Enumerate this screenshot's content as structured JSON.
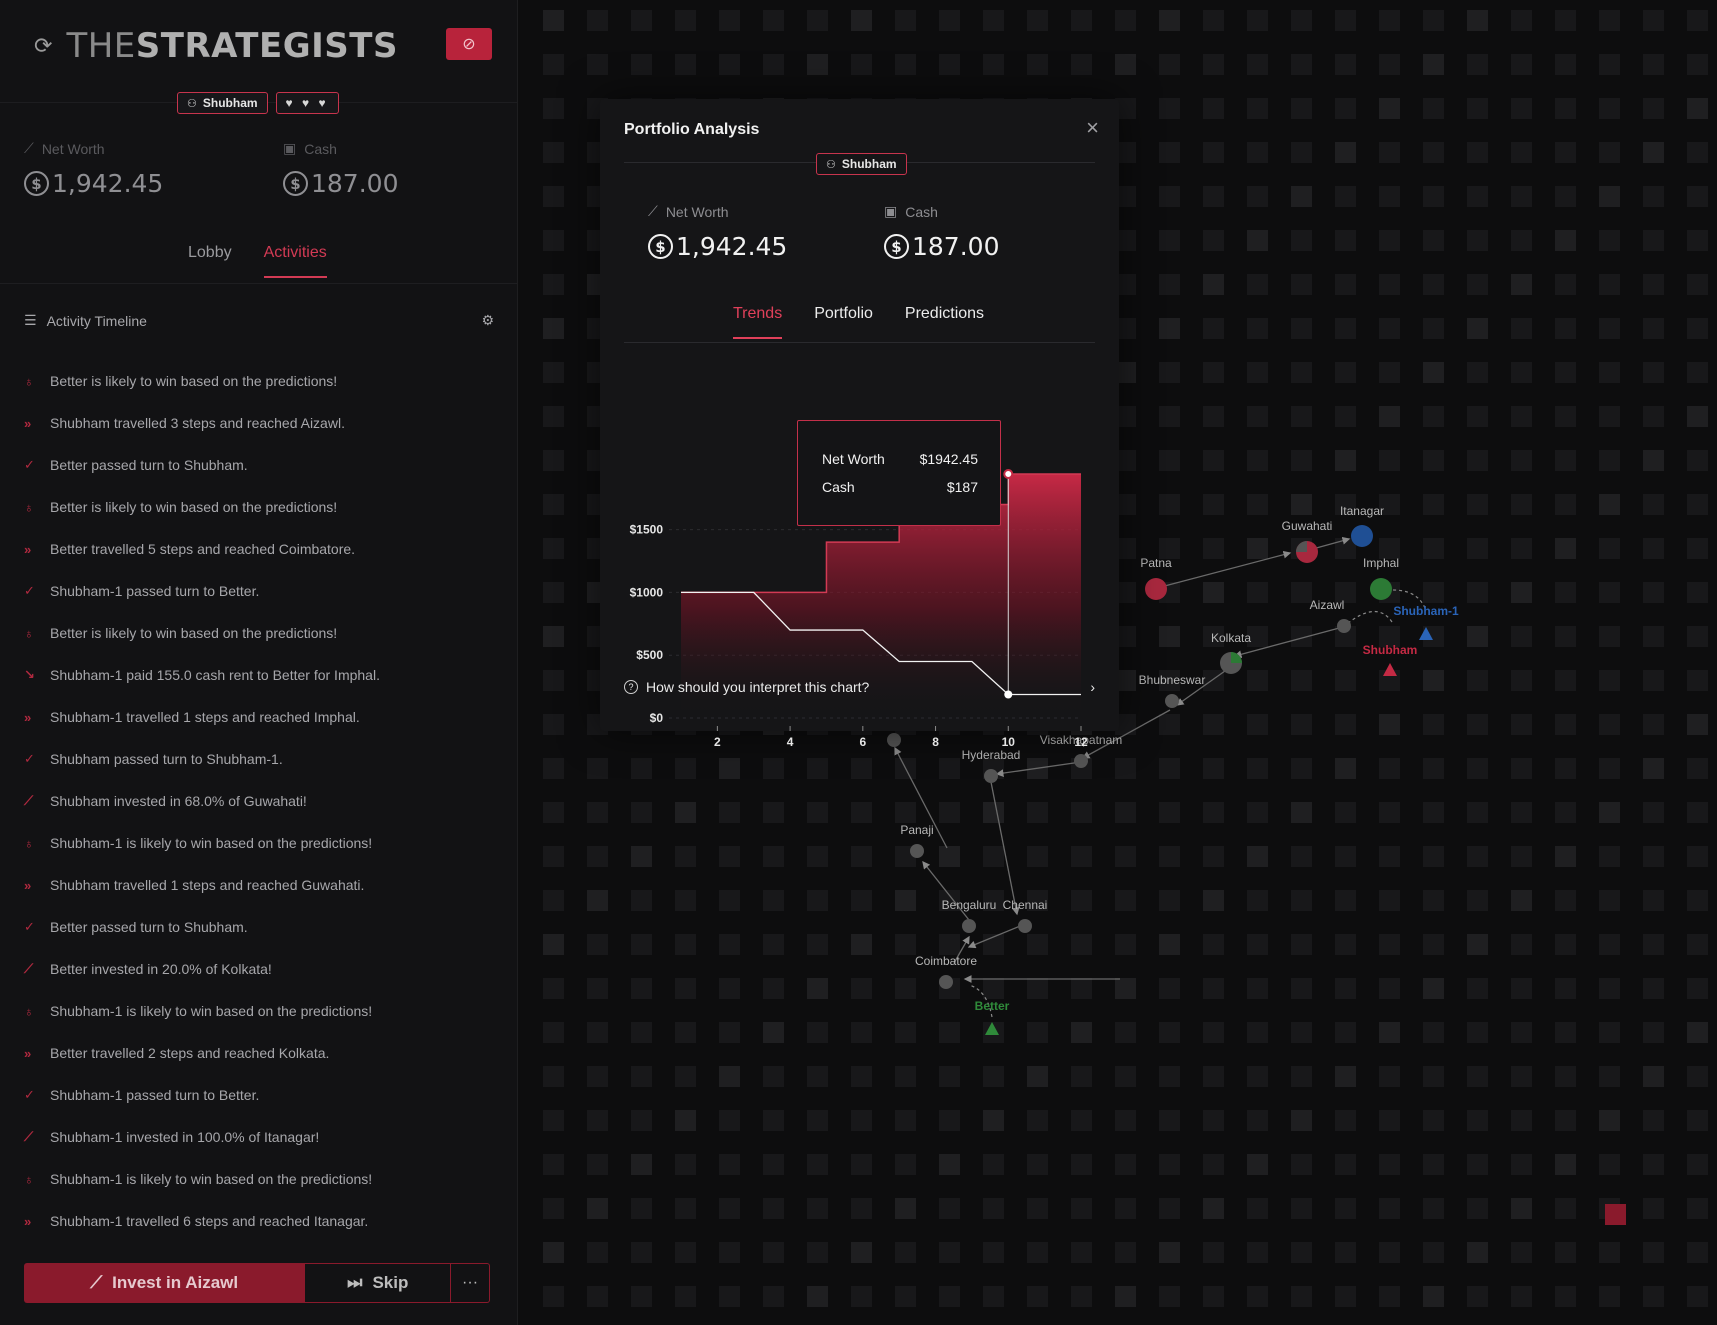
{
  "app": {
    "logo_prefix": "THE",
    "logo_bold": "STRATEGISTS",
    "player_name": "Shubham",
    "lives": "♥ ♥ ♥"
  },
  "stats": {
    "net_worth_label": "Net Worth",
    "net_worth_value": "1,942.45",
    "cash_label": "Cash",
    "cash_value": "187.00"
  },
  "sidebar_tabs": [
    {
      "label": "Lobby",
      "active": false
    },
    {
      "label": "Activities",
      "active": true
    }
  ],
  "timeline": {
    "title": "Activity Timeline",
    "items": [
      {
        "type": "prediction",
        "text": "Better is likely to win based on the predictions!"
      },
      {
        "type": "travel",
        "text": "Shubham travelled 3 steps and reached Aizawl."
      },
      {
        "type": "pass",
        "text": "Better passed turn to Shubham."
      },
      {
        "type": "prediction",
        "text": "Better is likely to win based on the predictions!"
      },
      {
        "type": "travel",
        "text": "Better travelled 5 steps and reached Coimbatore."
      },
      {
        "type": "pass",
        "text": "Shubham-1 passed turn to Better."
      },
      {
        "type": "prediction",
        "text": "Better is likely to win based on the predictions!"
      },
      {
        "type": "rent",
        "text": "Shubham-1 paid 155.0 cash rent to Better for Imphal."
      },
      {
        "type": "travel",
        "text": "Shubham-1 travelled 1 steps and reached Imphal."
      },
      {
        "type": "pass",
        "text": "Shubham passed turn to Shubham-1."
      },
      {
        "type": "invest",
        "text": "Shubham invested in 68.0% of Guwahati!"
      },
      {
        "type": "prediction",
        "text": "Shubham-1 is likely to win based on the predictions!"
      },
      {
        "type": "travel",
        "text": "Shubham travelled 1 steps and reached Guwahati."
      },
      {
        "type": "pass",
        "text": "Better passed turn to Shubham."
      },
      {
        "type": "invest",
        "text": "Better invested in 20.0% of Kolkata!"
      },
      {
        "type": "prediction",
        "text": "Shubham-1 is likely to win based on the predictions!"
      },
      {
        "type": "travel",
        "text": "Better travelled 2 steps and reached Kolkata."
      },
      {
        "type": "pass",
        "text": "Shubham-1 passed turn to Better."
      },
      {
        "type": "invest",
        "text": "Shubham-1 invested in 100.0% of Itanagar!"
      },
      {
        "type": "prediction",
        "text": "Shubham-1 is likely to win based on the predictions!"
      },
      {
        "type": "travel",
        "text": "Shubham-1 travelled 6 steps and reached Itanagar."
      }
    ]
  },
  "actions": {
    "invest_label": "Invest in Aizawl",
    "skip_label": "Skip",
    "more_label": "···"
  },
  "modal": {
    "title": "Portfolio Analysis",
    "player_name": "Shubham",
    "tabs": [
      {
        "label": "Trends",
        "active": true
      },
      {
        "label": "Portfolio",
        "active": false
      },
      {
        "label": "Predictions",
        "active": false
      }
    ],
    "tooltip": {
      "net_worth_label": "Net Worth",
      "net_worth_value": "$1942.45",
      "cash_label": "Cash",
      "cash_value": "$187"
    },
    "interpret_label": "How should you interpret this chart?"
  },
  "chart_data": {
    "type": "area",
    "x": [
      1,
      2,
      3,
      4,
      5,
      6,
      7,
      8,
      9,
      10,
      11,
      12
    ],
    "series": [
      {
        "name": "Net Worth",
        "values": [
          1000,
          1000,
          1000,
          1000,
          1400,
          1400,
          1700,
          1700,
          1700,
          1942.45,
          1942.45,
          1942.45
        ],
        "color": "#c42a44"
      },
      {
        "name": "Cash",
        "values": [
          1000,
          1000,
          1000,
          700,
          700,
          700,
          450,
          450,
          450,
          187,
          187,
          187
        ],
        "color": "#ffffff"
      }
    ],
    "xticks": [
      2,
      4,
      6,
      8,
      10,
      12
    ],
    "yticks": [
      0,
      500,
      1000,
      1500
    ],
    "ytick_labels": [
      "$0",
      "$500",
      "$1000",
      "$1500"
    ],
    "xlim": [
      1,
      12
    ],
    "ylim": [
      0,
      1942.45
    ],
    "highlight_x": 10
  },
  "map": {
    "cities": [
      {
        "name": "Patna",
        "owner_color": "#c42a44"
      },
      {
        "name": "Guwahati",
        "owner_color": "#c42a44"
      },
      {
        "name": "Itanagar",
        "owner_color": "#2a64b8"
      },
      {
        "name": "Imphal",
        "owner_color": "#2f8a3a"
      },
      {
        "name": "Aizawl",
        "owner_color": "#555555"
      },
      {
        "name": "Kolkata",
        "owner_color": "#555555"
      },
      {
        "name": "Bhubneswar",
        "owner_color": "#555555"
      },
      {
        "name": "Visakhapatnam",
        "owner_color": "#555555"
      },
      {
        "name": "Hyderabad",
        "owner_color": "#555555"
      },
      {
        "name": "Panaji",
        "owner_color": "#555555"
      },
      {
        "name": "Bengaluru",
        "owner_color": "#555555"
      },
      {
        "name": "Chennai",
        "owner_color": "#555555"
      },
      {
        "name": "Coimbatore",
        "owner_color": "#555555"
      }
    ],
    "players": [
      {
        "name": "Shubham-1",
        "color": "#2a64b8"
      },
      {
        "name": "Shubham",
        "color": "#c42a44"
      },
      {
        "name": "Better",
        "color": "#2f8a3a"
      }
    ]
  }
}
